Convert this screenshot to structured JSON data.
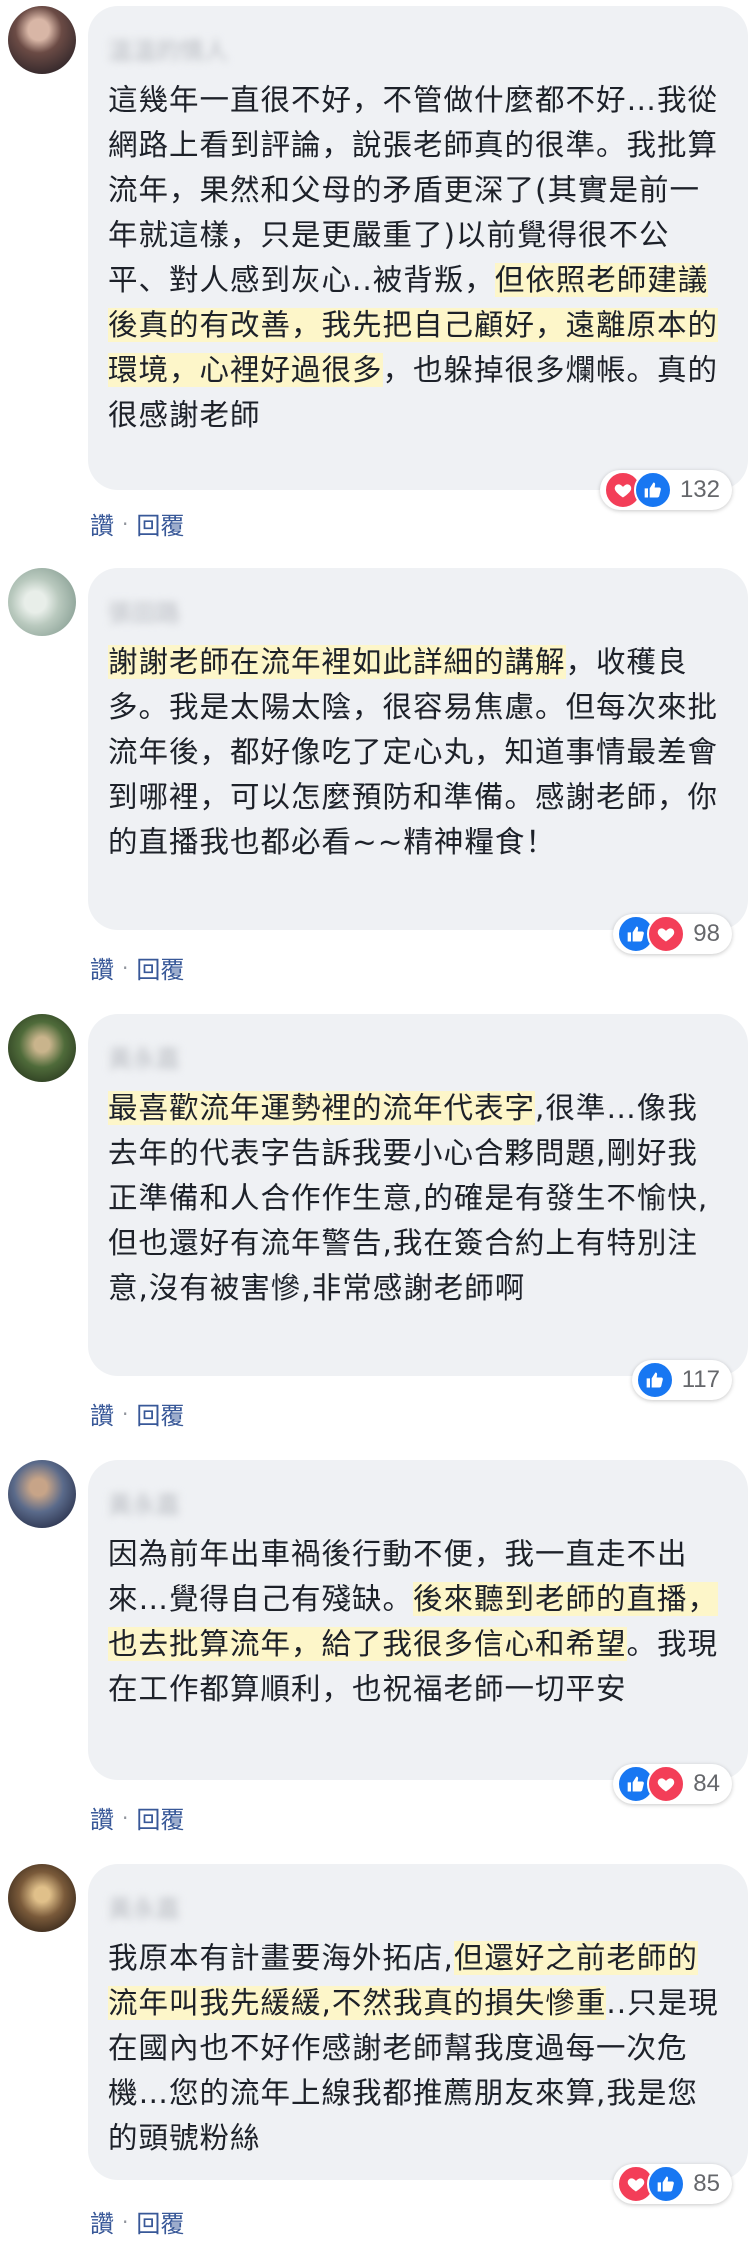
{
  "actions": {
    "like_label": "讚",
    "separator": "·",
    "reply_label": "回覆"
  },
  "comments": [
    {
      "author": "溫溫的情人",
      "text_before": "這幾年一直很不好，不管做什麼都不好…我從網路上看到評論，說張老師真的很準。我批算流年，果然和父母的矛盾更深了(其實是前一年就這樣，只是更嚴重了)以前覺得很不公平、對人感到灰心..被背叛，",
      "text_highlight": "但依照老師建議後真的有改善，我先把自己顧好，遠離原本的環境，心裡好過很多",
      "text_after": "，也躲掉很多爛帳。真的很感謝老師",
      "reactions": [
        "heart",
        "like"
      ],
      "count": "132"
    },
    {
      "author": "張田路",
      "text_before": "",
      "text_highlight": "謝謝老師在流年裡如此詳細的講解",
      "text_after": "，收穫良多。我是太陽太陰，很容易焦慮。但每次來批流年後，都好像吃了定心丸，知道事情最差會到哪裡，可以怎麼預防和準備。感謝老師，你的直播我也都必看~~精神糧食！",
      "reactions": [
        "like",
        "heart"
      ],
      "count": "98"
    },
    {
      "author": "黃永嘉",
      "text_before": "",
      "text_highlight": "最喜歡流年運勢裡的流年代表字",
      "text_after": ",很準…像我去年的代表字告訴我要小心合夥問題,剛好我正準備和人合作作生意,的確是有發生不愉快,但也還好有流年警告,我在簽合約上有特別注意,沒有被害慘,非常感謝老師啊",
      "reactions": [
        "like"
      ],
      "count": "117"
    },
    {
      "author": "黃永嘉",
      "text_before": "因為前年出車禍後行動不便，我一直走不出來…覺得自己有殘缺。",
      "text_highlight": "後來聽到老師的直播，也去批算流年，給了我很多信心和希望",
      "text_after": "。我現在工作都算順利，也祝福老師一切平安",
      "reactions": [
        "like",
        "heart"
      ],
      "count": "84"
    },
    {
      "author": "黃永嘉",
      "text_before": "我原本有計畫要海外拓店,",
      "text_highlight": "但還好之前老師的流年叫我先緩緩,不然我真的損失慘重",
      "text_after": "..只是現在國內也不好作感謝老師幫我度過每一次危機…您的流年上線我都推薦朋友來算,我是您的頭號粉絲",
      "reactions": [
        "heart",
        "like"
      ],
      "count": "85"
    }
  ],
  "colors": {
    "bubble": "#eff1f4",
    "highlight": "#fdf6c9",
    "link": "#385898",
    "like": "#1877f2",
    "heart": "#f33e58"
  }
}
